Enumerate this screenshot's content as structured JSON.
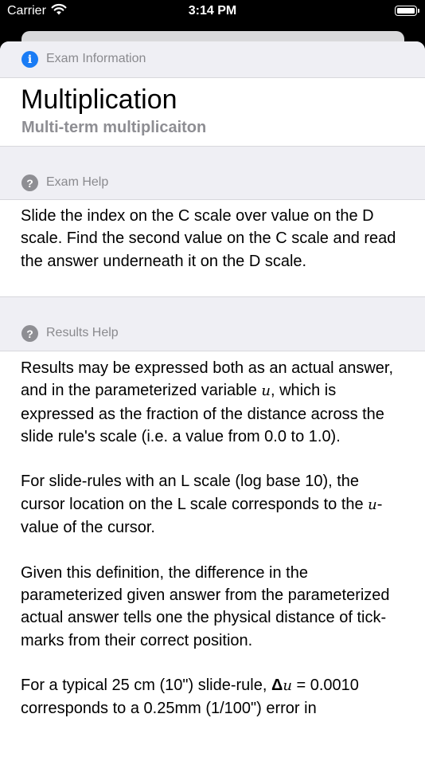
{
  "status_bar": {
    "carrier": "Carrier",
    "time": "3:14 PM"
  },
  "exam_info": {
    "header": "Exam Information",
    "title": "Multiplication",
    "subtitle": "Multi-term multiplicaiton"
  },
  "exam_help": {
    "header": "Exam Help",
    "text": "Slide the index on the C scale over value on the D scale.  Find the second value on the C scale and read the answer underneath it on the D scale."
  },
  "results_help": {
    "header": "Results Help",
    "p1_a": "Results may be expressed both as an actual answer, and in the parameterized variable ",
    "p1_var": "u",
    "p1_b": ", which is expressed as the fraction of the distance across the slide rule's scale (i.e. a value from 0.0 to 1.0).",
    "p2_a": "For slide-rules with an L scale (log base 10), the cursor location on the L scale corresponds to the ",
    "p2_var": "u",
    "p2_b": "-value of the cursor.",
    "p3": "Given this definition, the difference in the parameterized given answer from the parameterized actual answer tells one the physical distance of tick-marks from their correct position.",
    "p4_a": "For a typical 25 cm (10\") slide-rule, ",
    "p4_delta": "Δ",
    "p4_var": "u",
    "p4_b": " = 0.0010 corresponds to a 0.25mm (1/100\") error in"
  },
  "icons": {
    "info": "info-icon",
    "help": "question-icon",
    "wifi": "wifi-icon",
    "battery": "battery-icon"
  },
  "colors": {
    "info_blue": "#1a7cf5",
    "help_gray": "#8e8e93",
    "section_bg": "#efeff4"
  }
}
